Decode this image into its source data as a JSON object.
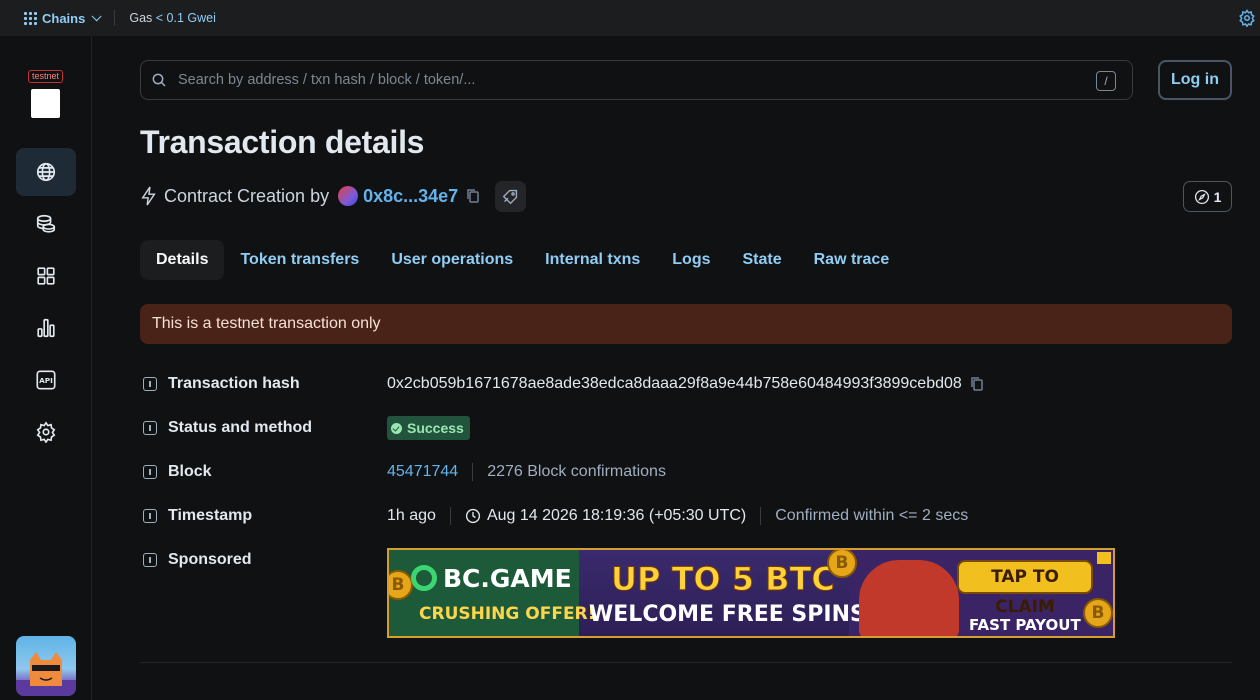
{
  "topbar": {
    "chains_label": "Chains",
    "gas_label": "Gas",
    "gas_value": "< 0.1 Gwei",
    "icons": [
      "grid-icon",
      "chevron-down-icon",
      "gear-icon"
    ]
  },
  "sidebar": {
    "badge": "testnet",
    "items": [
      {
        "name": "blockchain",
        "icon": "globe-icon",
        "active": true
      },
      {
        "name": "tokens",
        "icon": "coins-icon",
        "active": false
      },
      {
        "name": "apps",
        "icon": "apps-grid-icon",
        "active": false
      },
      {
        "name": "charts",
        "icon": "bar-chart-icon",
        "active": false
      },
      {
        "name": "api",
        "icon": "api-icon",
        "active": false,
        "text": "API"
      },
      {
        "name": "settings",
        "icon": "gear-icon",
        "active": false
      }
    ]
  },
  "search": {
    "placeholder": "Search by address / txn hash / block / token/...",
    "shortcut": "/"
  },
  "login_label": "Log in",
  "page_title": "Transaction details",
  "subheader": {
    "prefix": "Contract Creation by",
    "address": "0x8c...34e7",
    "nonce": "1"
  },
  "tabs": [
    "Details",
    "Token transfers",
    "User operations",
    "Internal txns",
    "Logs",
    "State",
    "Raw trace"
  ],
  "alert": "This is a testnet transaction only",
  "details": {
    "tx_hash_label": "Transaction hash",
    "tx_hash": "0x2cb059b1671678ae8ade38edca8daaa29f8a9e44b758e60484993f3899cebd08",
    "status_label": "Status and method",
    "status": "Success",
    "block_label": "Block",
    "block": "45471744",
    "block_confirmations": "2276 Block confirmations",
    "timestamp_label": "Timestamp",
    "timestamp_ago": "1h ago",
    "timestamp": "Aug 14 2026 18:19:36 (+05:30 UTC)",
    "confirmed": "Confirmed within <= 2 secs",
    "sponsored_label": "Sponsored"
  },
  "ad": {
    "brand": "BC.GAME",
    "tagline": "CRUSHING OFFER!",
    "headline": "UP TO 5 BTC",
    "subline": "WELCOME FREE SPINS",
    "cta": "TAP TO CLAIM",
    "footer": "FAST PAYOUT",
    "coin_symbol": "B"
  },
  "colors": {
    "accent": "#63b3ed",
    "success_bg": "#22543d",
    "alert_bg": "#4a2318",
    "background": "#101112"
  }
}
